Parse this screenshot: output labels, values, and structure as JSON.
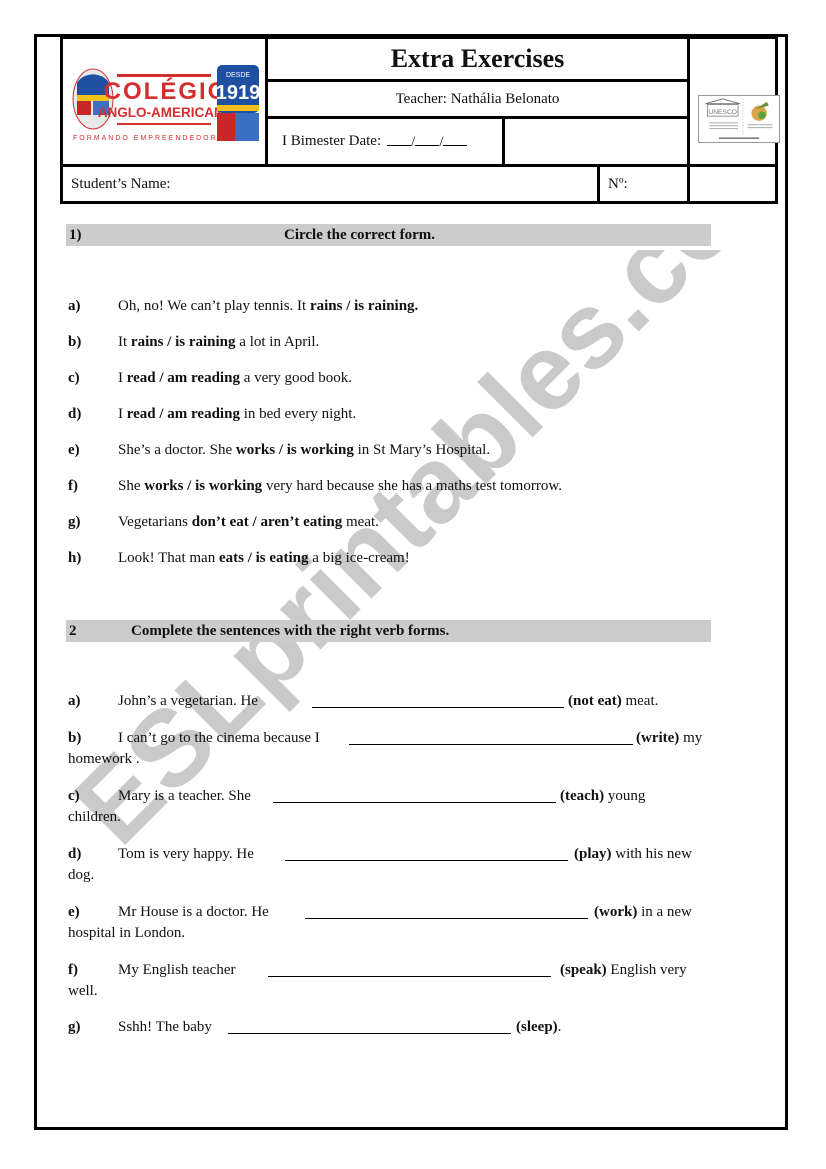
{
  "header": {
    "logo": {
      "name": "COLÉGIO",
      "subname": "ANGLO-AMERICANO",
      "tagline": "FORMANDO EMPREENDEDORES",
      "since_label": "DESDE",
      "since_year": "1919"
    },
    "title": "Extra Exercises",
    "teacher": "Teacher: Nathália Belonato",
    "date_label": "I  Bimester Date:",
    "date_separator": "/",
    "student_name_label": "Student’s Name:",
    "number_label": "Nº:",
    "unesco_logo": "UNESCO"
  },
  "section1": {
    "number": "1)",
    "instruction": "Circle the correct form.",
    "items": [
      {
        "letter": "a)",
        "before": "Oh, no! We can’t play tennis. It ",
        "choice": "rains / is raining.",
        "after": ""
      },
      {
        "letter": "b)",
        "before": "It ",
        "choice": "rains / is raining",
        "after": " a lot in April."
      },
      {
        "letter": "c)",
        "before": "I ",
        "choice": "read / am reading",
        "after": " a very good book."
      },
      {
        "letter": "d)",
        "before": "I ",
        "choice": "read / am reading",
        "after": " in bed every night."
      },
      {
        "letter": "e)",
        "before": "She’s a doctor. She ",
        "choice": "works / is working",
        "after": " in St Mary’s Hospital."
      },
      {
        "letter": "f)",
        "before": "She ",
        "choice": "works / is working",
        "after": " very hard because she has a maths test tomorrow."
      },
      {
        "letter": "g)",
        "before": "Vegetarians ",
        "choice": "don’t eat / aren’t eating",
        "after": " meat."
      },
      {
        "letter": "h)",
        "before": "Look! That man ",
        "choice": "eats / is eating",
        "after": " a big ice-cream!"
      }
    ]
  },
  "section2": {
    "number": "2",
    "instruction": "Complete the sentences with the right verb forms.",
    "items": [
      {
        "letter": "a)",
        "before": "John’s a vegetarian. He",
        "verb": "(not eat)",
        "after": " meat.",
        "continuation": ""
      },
      {
        "letter": "b)",
        "before": "I can’t go to the cinema because I",
        "verb": "(write)",
        "after": " my",
        "continuation": "homework ."
      },
      {
        "letter": "c)",
        "before": "Mary is a teacher. She",
        "verb": "(teach)",
        "after": " young",
        "continuation": "children."
      },
      {
        "letter": "d)",
        "before": "Tom is very happy. He",
        "verb": "(play)",
        "after": " with his new",
        "continuation": "dog."
      },
      {
        "letter": "e)",
        "before": "Mr House is a doctor. He",
        "verb": "(work)",
        "after": " in a new",
        "continuation": "hospital in London."
      },
      {
        "letter": "f)",
        "before": "My English teacher",
        "verb": "(speak)",
        "after": " English very",
        "continuation": "well."
      },
      {
        "letter": "g)",
        "before": "Sshh! The baby",
        "verb": "(sleep)",
        "after": ".",
        "continuation": ""
      }
    ]
  },
  "watermark": "ESLprintables.com"
}
